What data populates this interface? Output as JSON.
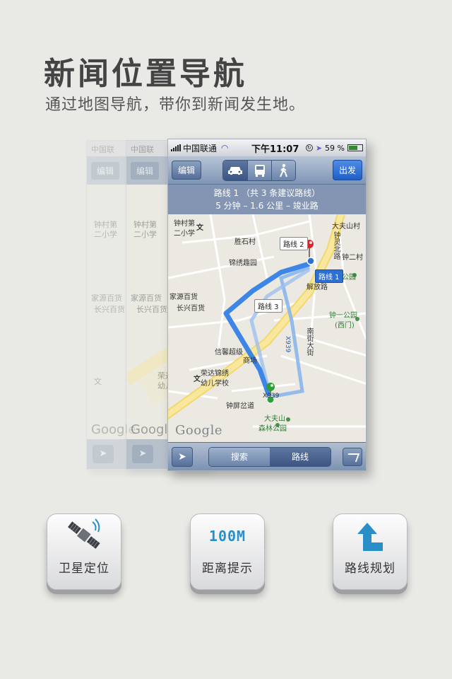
{
  "headline": "新闻位置导航",
  "subline": "通过地图导航，带你到新闻发生地。",
  "ghosts": {
    "carrier": "中国联",
    "edit_label": "编辑",
    "labels": [
      "钟村第",
      "二小学",
      "文",
      "家源百货",
      "长兴百货",
      "荣达",
      "幼儿",
      "文",
      "Google"
    ]
  },
  "phone": {
    "status": {
      "carrier": "中国联通",
      "time": "下午11:07",
      "battery": "59 %"
    },
    "navbar": {
      "edit_label": "编辑",
      "modes": [
        "car-icon",
        "bus-icon",
        "walk-icon"
      ],
      "go_label": "出发"
    },
    "route_info": {
      "line1": "路线 1 （共 3 条建议路线）",
      "line2": "5 分钟 – 1.6 公里 – 竣业路"
    },
    "map": {
      "labels": {
        "zhongcun": "钟村第",
        "erxiaoxue": "二小学",
        "wen1": "文",
        "shengshi": "胜石村",
        "jinxiu": "锦绣趣园",
        "jiayuan": "家源百货",
        "changxing": "长兴百货",
        "wen2": "文",
        "rongda1": "荣达锦绣",
        "rongda2": "幼儿学校",
        "xinxin": "信馨超级",
        "shangchang": "商场",
        "zhongping": "钟屏岔道",
        "dafushan1": "大夫山",
        "dafushan2": "森林公园",
        "park": "公园",
        "zhongyi1": "钟一公园",
        "zhongyi2": "(西门)",
        "dayiyuan": "大夫山村",
        "zhongling": "钟灵北路",
        "zhonger": "钟二村",
        "x939": "X939",
        "x939b": "X939",
        "jiefang": "解放路",
        "nanjie": "南街大街",
        "google": "Google"
      },
      "route_tags": [
        "路线 1",
        "路线 2",
        "路线 3"
      ]
    },
    "bottombar": {
      "search_label": "搜索",
      "route_label": "路线"
    }
  },
  "features": [
    {
      "label": "卫星定位",
      "icon": "satellite-icon"
    },
    {
      "label": "距离提示",
      "icon": "distance-100m-icon",
      "text": "100M"
    },
    {
      "label": "路线规划",
      "icon": "route-turn-arrow-icon"
    }
  ],
  "colors": {
    "route": "#3d86e8",
    "nav_bar": "#7f95b5",
    "go_button": "#2d6fd3",
    "pin_start": "#2e9e3a",
    "pin_end": "#d6242b"
  }
}
